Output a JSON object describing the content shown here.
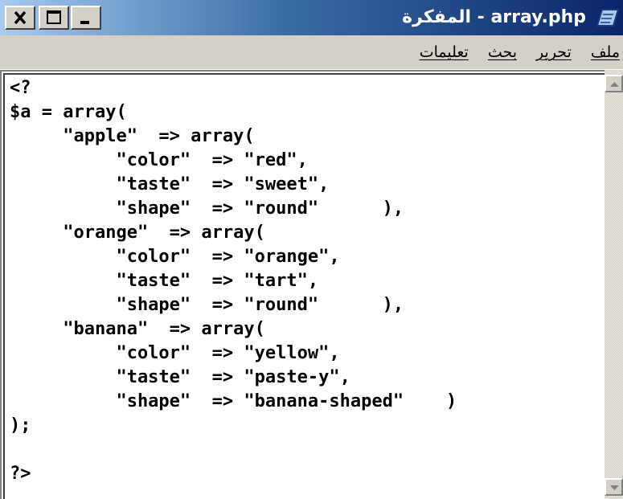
{
  "window": {
    "title": "المفكرة - array.php"
  },
  "icons": {
    "app": "notepad-icon",
    "close": "close-icon",
    "maximize": "maximize-icon",
    "minimize": "minimize-icon",
    "scroll_up": "scroll-up-arrow-icon",
    "scroll_down": "scroll-down-arrow-icon"
  },
  "menu": {
    "items": [
      {
        "label": "ملف"
      },
      {
        "label": "تحرير"
      },
      {
        "label": "بحث"
      },
      {
        "label": "تعليمات"
      }
    ]
  },
  "editor": {
    "lines": [
      "<?",
      "$a = array(",
      "     \"apple\"  => array(",
      "          \"color\"  => \"red\",",
      "          \"taste\"  => \"sweet\",",
      "          \"shape\"  => \"round\"      ),",
      "     \"orange\"  => array(",
      "          \"color\"  => \"orange\",",
      "          \"taste\"  => \"tart\",",
      "          \"shape\"  => \"round\"      ),",
      "     \"banana\"  => array(",
      "          \"color\"  => \"yellow\",",
      "          \"taste\"  => \"paste-y\",",
      "          \"shape\"  => \"banana-shaped\"    )",
      ");",
      "",
      "?>"
    ]
  },
  "colors": {
    "titlebar_dark": "#0a246a",
    "titlebar_light": "#a6caf0",
    "chrome": "#d4d0c8"
  }
}
